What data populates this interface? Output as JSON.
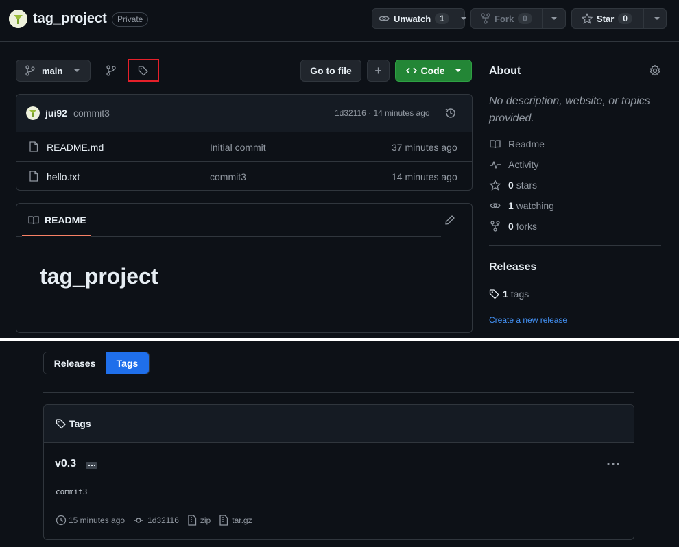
{
  "repo": {
    "name": "tag_project",
    "visibility": "Private"
  },
  "header_actions": {
    "unwatch_label": "Unwatch",
    "unwatch_count": "1",
    "fork_label": "Fork",
    "fork_count": "0",
    "star_label": "Star",
    "star_count": "0"
  },
  "toolbar": {
    "branch": "main",
    "go_to_file": "Go to file",
    "add": "+",
    "code": "Code"
  },
  "latest_commit": {
    "author": "jui92",
    "message": "commit3",
    "hash_time": "1d32116 · 14 minutes ago"
  },
  "files": [
    {
      "name": "README.md",
      "message": "Initial commit",
      "time": "37 minutes ago"
    },
    {
      "name": "hello.txt",
      "message": "commit3",
      "time": "14 minutes ago"
    }
  ],
  "readme": {
    "tab": "README",
    "heading": "tag_project"
  },
  "about": {
    "title": "About",
    "description": "No description, website, or topics provided.",
    "items": [
      {
        "icon": "book-icon",
        "label": "Readme",
        "bold": ""
      },
      {
        "icon": "pulse-icon",
        "label": "Activity",
        "bold": ""
      },
      {
        "icon": "star-icon",
        "label": "stars",
        "bold": "0"
      },
      {
        "icon": "eye-icon",
        "label": "watching",
        "bold": "1"
      },
      {
        "icon": "fork-icon",
        "label": "forks",
        "bold": "0"
      }
    ],
    "releases_title": "Releases",
    "tags_count": "1",
    "tags_label": "tags",
    "create_release": "Create a new release"
  },
  "tags_page": {
    "tab_releases": "Releases",
    "tab_tags": "Tags",
    "box_title": "Tags",
    "tag_name": "v0.3",
    "commit_message": "commit3",
    "time": "15 minutes ago",
    "hash": "1d32116",
    "zip": "zip",
    "targz": "tar.gz"
  },
  "colors": {
    "background": "#0d1117",
    "code_button": "#238636",
    "tags_tab_active": "#1f6feb",
    "highlight_box": "#e5202a"
  }
}
